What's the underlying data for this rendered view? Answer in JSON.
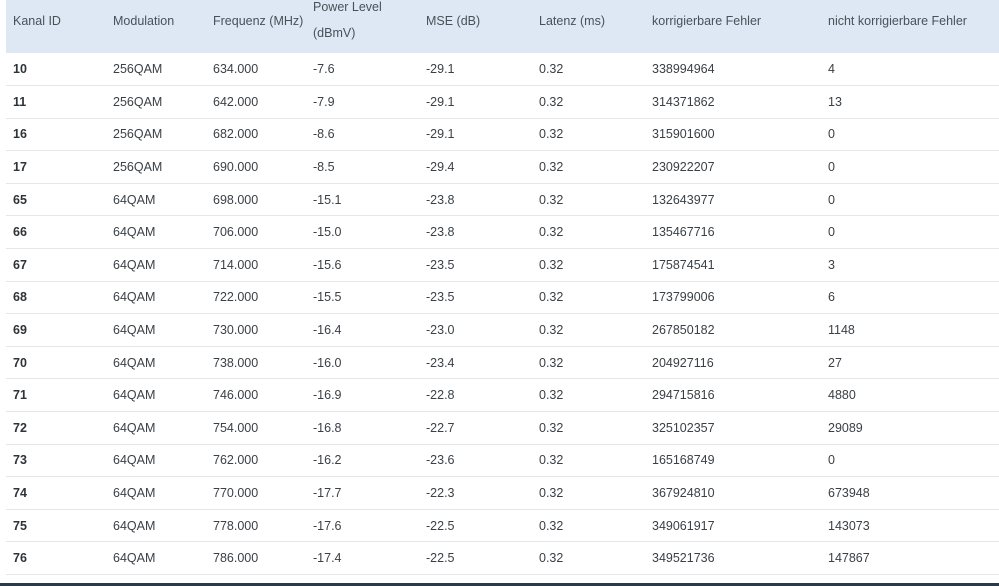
{
  "table": {
    "headers": {
      "kanal_id": "Kanal ID",
      "modulation": "Modulation",
      "frequenz": "Frequenz (MHz)",
      "power_level_line1": "Power Level",
      "power_level_line2": "(dBmV)",
      "mse": "MSE (dB)",
      "latenz": "Latenz (ms)",
      "korrigierbar": "korrigierbare Fehler",
      "nicht_korrigierbar": "nicht korrigierbare Fehler"
    },
    "rows": [
      [
        "10",
        "256QAM",
        "634.000",
        "-7.6",
        "-29.1",
        "0.32",
        "338994964",
        "4"
      ],
      [
        "11",
        "256QAM",
        "642.000",
        "-7.9",
        "-29.1",
        "0.32",
        "314371862",
        "13"
      ],
      [
        "16",
        "256QAM",
        "682.000",
        "-8.6",
        "-29.1",
        "0.32",
        "315901600",
        "0"
      ],
      [
        "17",
        "256QAM",
        "690.000",
        "-8.5",
        "-29.4",
        "0.32",
        "230922207",
        "0"
      ],
      [
        "65",
        "64QAM",
        "698.000",
        "-15.1",
        "-23.8",
        "0.32",
        "132643977",
        "0"
      ],
      [
        "66",
        "64QAM",
        "706.000",
        "-15.0",
        "-23.8",
        "0.32",
        "135467716",
        "0"
      ],
      [
        "67",
        "64QAM",
        "714.000",
        "-15.6",
        "-23.5",
        "0.32",
        "175874541",
        "3"
      ],
      [
        "68",
        "64QAM",
        "722.000",
        "-15.5",
        "-23.5",
        "0.32",
        "173799006",
        "6"
      ],
      [
        "69",
        "64QAM",
        "730.000",
        "-16.4",
        "-23.0",
        "0.32",
        "267850182",
        "1148"
      ],
      [
        "70",
        "64QAM",
        "738.000",
        "-16.0",
        "-23.4",
        "0.32",
        "204927116",
        "27"
      ],
      [
        "71",
        "64QAM",
        "746.000",
        "-16.9",
        "-22.8",
        "0.32",
        "294715816",
        "4880"
      ],
      [
        "72",
        "64QAM",
        "754.000",
        "-16.8",
        "-22.7",
        "0.32",
        "325102357",
        "29089"
      ],
      [
        "73",
        "64QAM",
        "762.000",
        "-16.2",
        "-23.6",
        "0.32",
        "165168749",
        "0"
      ],
      [
        "74",
        "64QAM",
        "770.000",
        "-17.7",
        "-22.3",
        "0.32",
        "367924810",
        "673948"
      ],
      [
        "75",
        "64QAM",
        "778.000",
        "-17.6",
        "-22.5",
        "0.32",
        "349061917",
        "143073"
      ],
      [
        "76",
        "64QAM",
        "786.000",
        "-17.4",
        "-22.5",
        "0.32",
        "349521736",
        "147867"
      ]
    ]
  },
  "colors": {
    "header_bg": "#dde8f4",
    "row_border": "#e4e6e9",
    "text": "#3a4046"
  }
}
